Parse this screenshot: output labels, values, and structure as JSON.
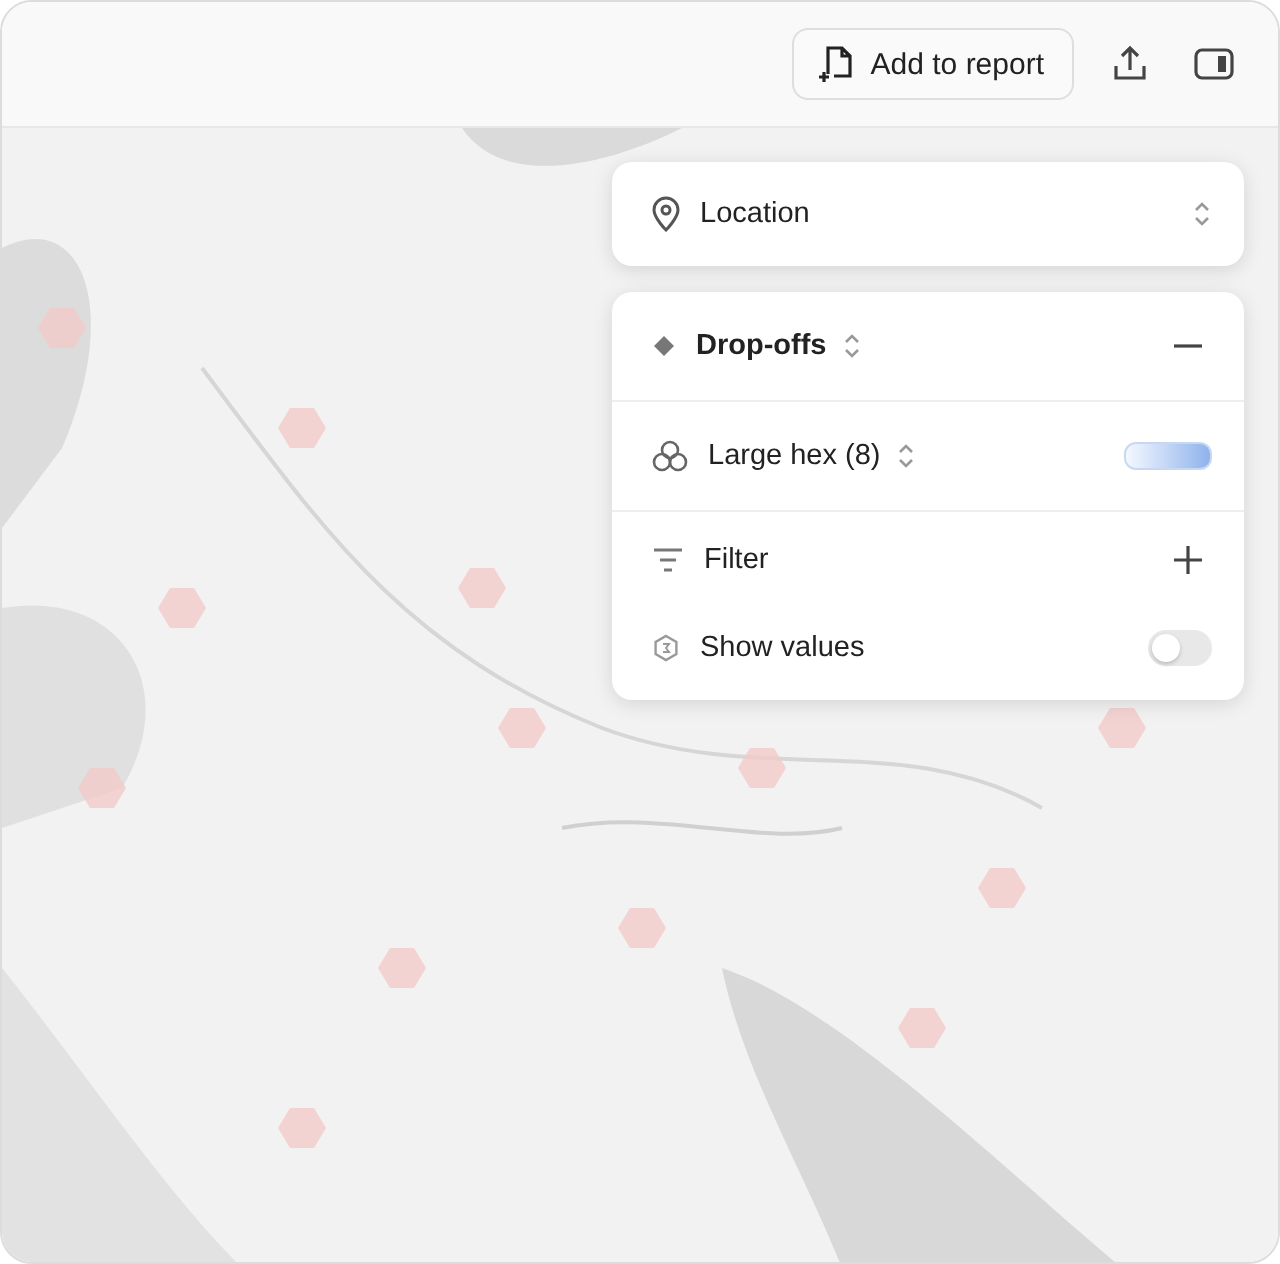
{
  "toolbar": {
    "add_button": "Add to report"
  },
  "location": {
    "label": "Location"
  },
  "layer": {
    "title": "Drop-offs",
    "expanded": true,
    "aggregation": "Large hex (8)",
    "filter": "Filter",
    "show_values": {
      "label": "Show values",
      "on": false
    }
  }
}
